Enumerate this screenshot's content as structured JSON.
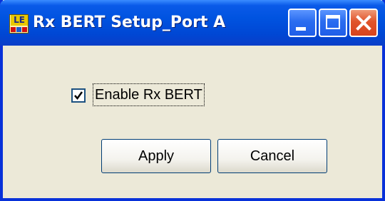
{
  "window": {
    "title": "Rx BERT Setup_Port A",
    "icon": "app-le-icon",
    "icon_text": "LE",
    "colors": {
      "titlebar": "#0053e0",
      "client": "#ece9d8",
      "close_button": "#e0542a"
    }
  },
  "form": {
    "enable_checkbox": {
      "label": "Enable Rx BERT",
      "checked": true
    }
  },
  "buttons": {
    "apply_label": "Apply",
    "cancel_label": "Cancel"
  }
}
